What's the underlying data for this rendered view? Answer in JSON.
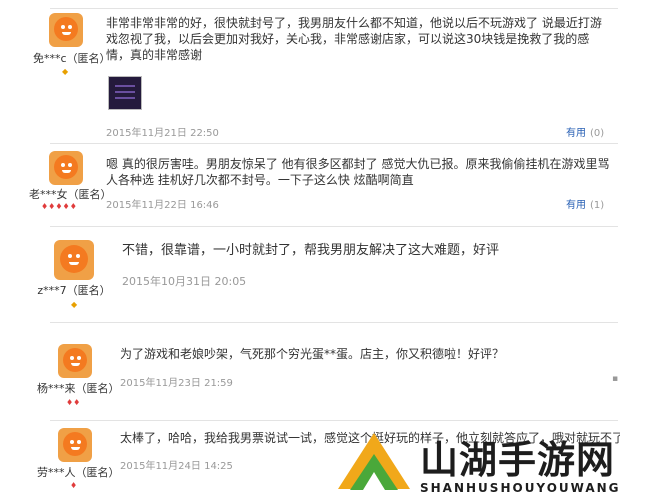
{
  "reviews": [
    {
      "user": "免***c（匿名）",
      "badge": "◆",
      "text": "非常非常非常的好，很快就封号了，我男朋友什么都不知道，他说以后不玩游戏了 说最近打游戏忽视了我，以后会更加对我好，关心我，非常感谢店家，可以说这30块钱是挽救了我的感情，真的非常感谢",
      "date": "2015年11月21日 22:50",
      "useful_label": "有用",
      "useful_count": "(0)"
    },
    {
      "user": "老***女（匿名）",
      "badge": "♦♦♦♦♦",
      "text": "嗯 真的很厉害哇。男朋友惊呆了 他有很多区都封了 感觉大仇已报。原来我偷偷挂机在游戏里骂人各种选 挂机好几次都不封号。一下子这么快 炫酷啊简直",
      "date": "2015年11月22日 16:46",
      "useful_label": "有用",
      "useful_count": "(1)"
    },
    {
      "user": "z***7（匿名）",
      "badge": "◆",
      "text": "不错，很靠谱，一小时就封了，帮我男朋友解决了这大难题，好评",
      "date": "2015年10月31日 20:05"
    },
    {
      "user": "杨***来（匿名）",
      "badge": "♦♦",
      "text": "为了游戏和老娘吵架，气死那个穷光蛋**蛋。店主，你又积德啦！好评？",
      "date": "2015年11月23日 21:59"
    },
    {
      "user": "劳***人（匿名）",
      "badge": "♦",
      "text": "太棒了，哈哈，我给我男票说试一试，感觉这个挺好玩的样子，他立刻就答应了，哦对就玩不了",
      "date": "2015年11月24日 14:25"
    }
  ],
  "watermark": {
    "title": "山湖手游网",
    "subtitle": "SHANHUSHOUYOUWANG"
  },
  "colors": {
    "avatar_bg": "#f0a046",
    "avatar_face": "#f47a20",
    "link": "#2a61b5",
    "logo_orange": "#f1a81a",
    "logo_green": "#4aa83a"
  }
}
